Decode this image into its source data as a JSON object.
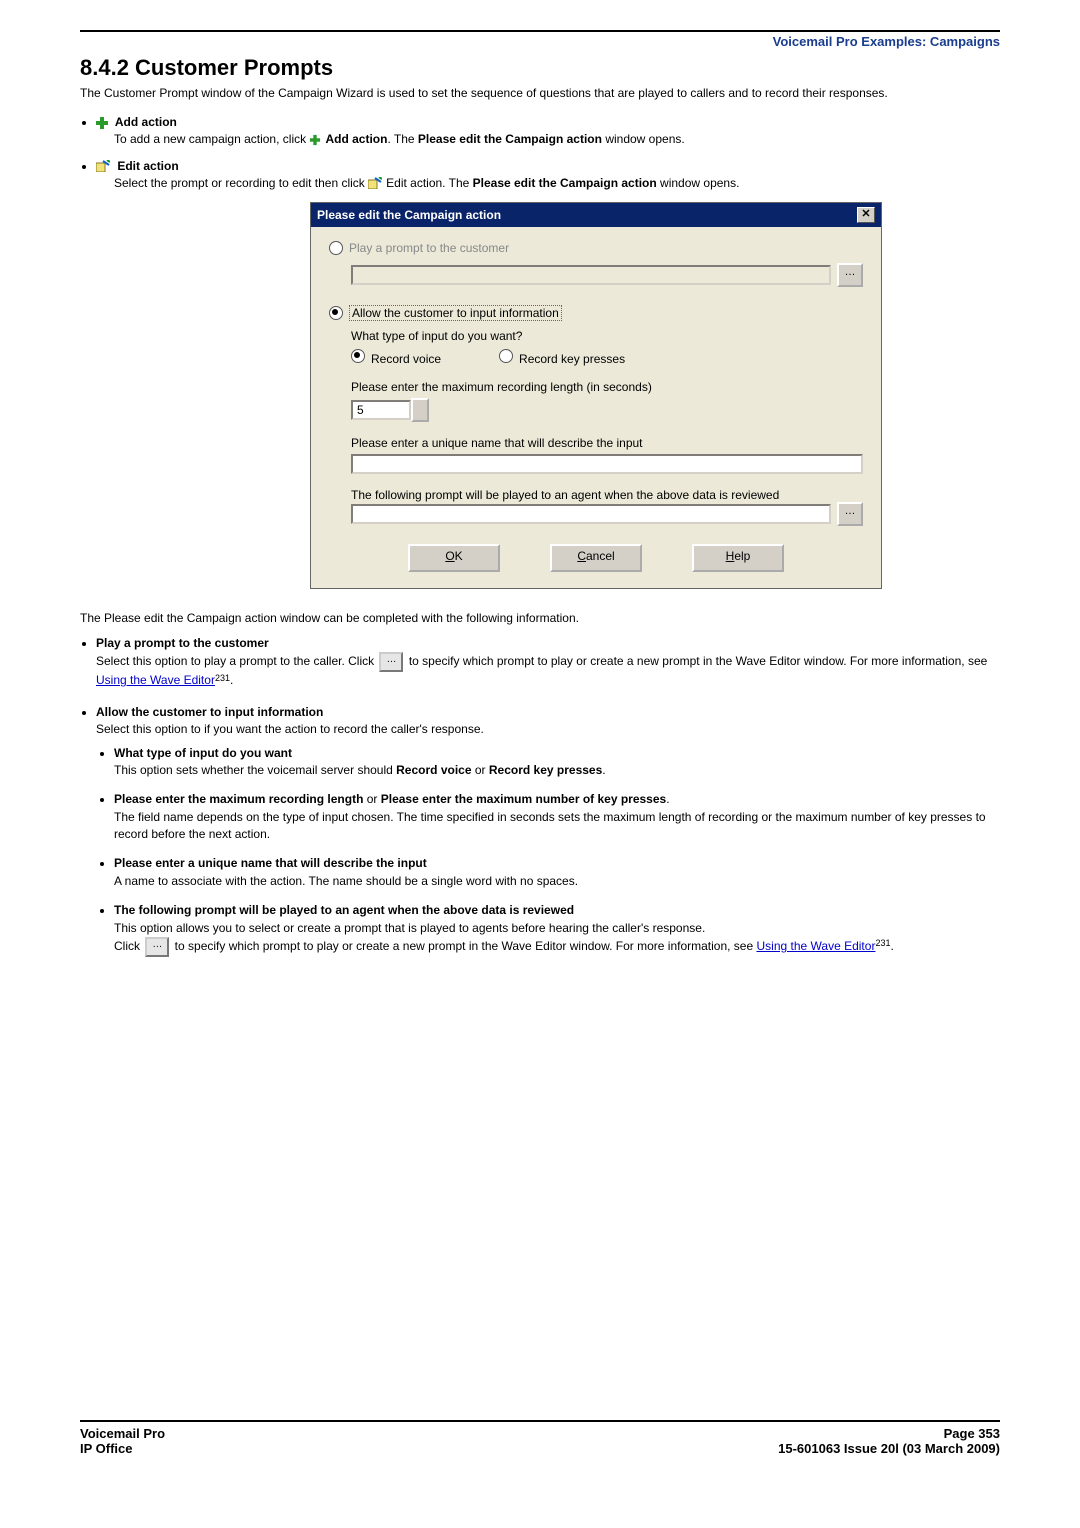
{
  "breadcrumb": "Voicemail Pro Examples: Campaigns",
  "heading": "8.4.2 Customer Prompts",
  "intro": "The Customer Prompt window of the Campaign Wizard is used to set the sequence of questions that are played to callers and to record their responses.",
  "add_action": {
    "label": "Add action",
    "text_prefix": "To add a new campaign action, click ",
    "text_bold1": "Add action",
    "text_mid": ". The ",
    "text_bold2": "Please edit the Campaign action",
    "text_suffix": " window opens."
  },
  "edit_action": {
    "label": "Edit action",
    "text_prefix": "Select the prompt or recording to edit then click ",
    "text_mid": "Edit action. The ",
    "text_bold": "Please edit the Campaign action",
    "text_suffix": " window opens."
  },
  "dialog": {
    "title": "Please edit the Campaign action",
    "opt_play": "Play a prompt to the customer",
    "opt_allow": "Allow the customer to input information",
    "q_type": "What type of input do you want?",
    "record_voice": "Record voice",
    "record_keys": "Record key presses",
    "max_len_label": "Please enter the maximum recording length (in seconds)",
    "max_len_value": "5",
    "unique_name_label": "Please enter a unique name that will describe the input",
    "agent_prompt_label": "The following prompt will be played to an agent when the above data is reviewed",
    "btn_ok_u": "O",
    "btn_ok_rest": "K",
    "btn_cancel_u": "C",
    "btn_cancel_rest": "ancel",
    "btn_help_u": "H",
    "btn_help_rest": "elp"
  },
  "below_intro": "The Please edit the Campaign action window can be completed with the following information.",
  "play_prompt": {
    "title": "Play a prompt to the customer",
    "t1": "Select this option to play a prompt to the caller. Click ",
    "t2": " to specify which prompt to play or create a new prompt in the Wave Editor window. For more information, see ",
    "link": "Using the Wave Editor",
    "ref": "231",
    "t3": "."
  },
  "allow_input": {
    "title": "Allow the customer to input information",
    "sub": "Select this option to if you want the action to record the caller's response.",
    "what_type": {
      "title": "What type of input do you want",
      "t1": "This option sets whether the voicemail server should ",
      "b1": "Record voice",
      "t2": " or ",
      "b2": "Record key presses",
      "t3": "."
    },
    "max": {
      "b1": "Please enter the maximum recording length",
      "mid": " or ",
      "b2": "Please enter the maximum number of key presses",
      "t3": ".",
      "desc": "The field name depends on the type of input chosen. The time specified in seconds sets the maximum length of recording or the maximum number of key presses to record before the next action."
    },
    "unique": {
      "title": "Please enter a unique name that will describe the input",
      "desc": "A name to associate with the action. The name should be a single word with no spaces."
    },
    "agent": {
      "title": "The following prompt will be played to an agent when the above data is reviewed",
      "d1": "This option allows you to select or create a prompt that is played to agents before hearing the caller's response.",
      "d2a": "Click ",
      "d2b": " to specify which prompt to play or create a new prompt in the Wave Editor window. For more information, see ",
      "link": "Using the Wave Editor",
      "ref": "231",
      "d2c": "."
    }
  },
  "footer": {
    "left1": "Voicemail Pro",
    "left2": "IP Office",
    "right1": "Page 353",
    "right2": "15-601063 Issue 20l (03 March 2009)"
  }
}
